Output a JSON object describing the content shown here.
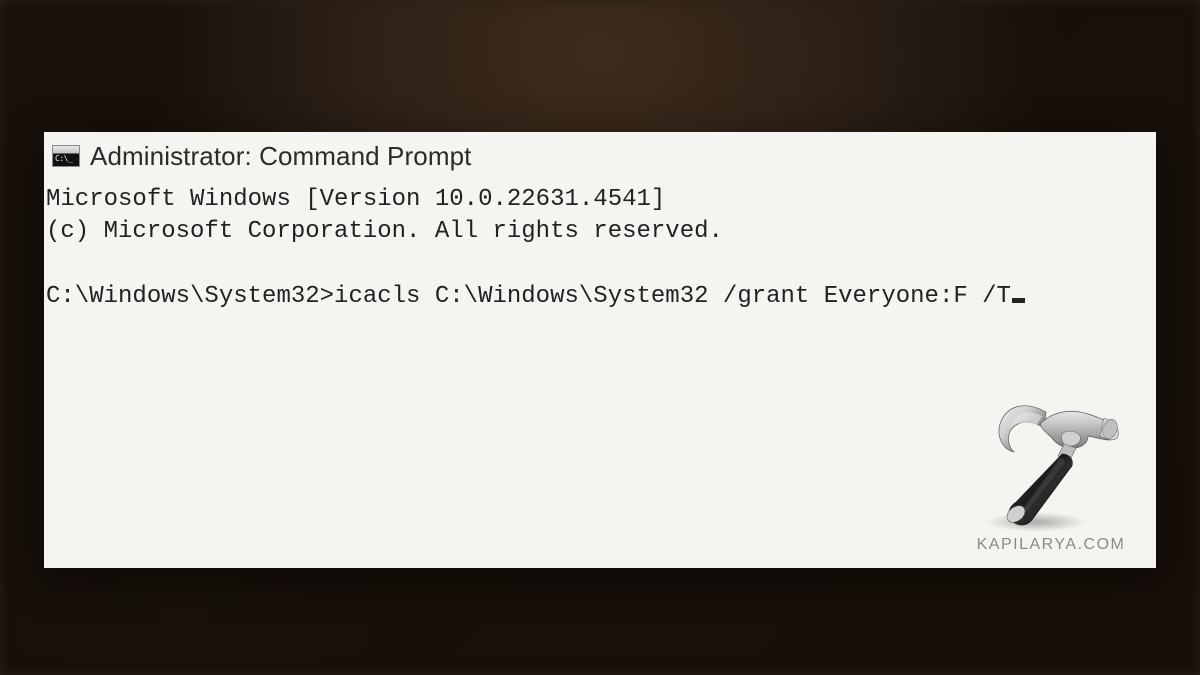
{
  "window": {
    "title": "Administrator: Command Prompt"
  },
  "console": {
    "line1": "Microsoft Windows [Version 10.0.22631.4541]",
    "line2": "(c) Microsoft Corporation. All rights reserved.",
    "prompt": "C:\\Windows\\System32>",
    "command": "icacls C:\\Windows\\System32 /grant Everyone:F /T"
  },
  "watermark": {
    "text": "KAPILARYA.COM"
  }
}
